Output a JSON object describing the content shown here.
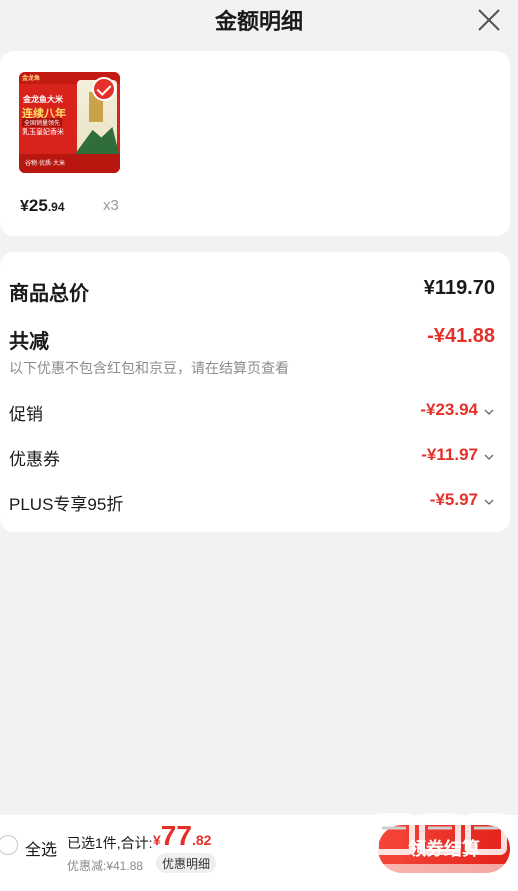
{
  "header": {
    "title": "金额明细"
  },
  "product": {
    "thumbnail": {
      "brand": "金龙鱼",
      "line1": "金龙鱼大米",
      "line2": "连续八年",
      "line3": "全国销量领先",
      "line4": "乳玉皇妃香米",
      "bottom": "谷物·优质·大米"
    },
    "price_symbol": "¥",
    "price_int": "25",
    "price_dec": ".94",
    "quantity": "x3"
  },
  "summary": {
    "total_label": "商品总价",
    "total_value": "¥119.70",
    "reduce_label": "共减",
    "reduce_value": "-¥41.88",
    "note": "以下优惠不包含红包和京豆，请在结算页查看",
    "promotion_label": "促销",
    "promotion_value": "-¥23.94",
    "coupon_label": "优惠券",
    "coupon_value": "-¥11.97",
    "plus_label": "PLUS专享95折",
    "plus_value": "-¥5.97"
  },
  "bottom_bar": {
    "select_all_label": "全选",
    "selected_summary": "已选1件,合计:",
    "total_symbol": "¥",
    "total_int": "77",
    "total_dec": ".82",
    "discount_summary": "优惠减:¥41.88",
    "detail_pill": "优惠明细",
    "checkout_label": "领券结算"
  },
  "colors": {
    "accent": "#e5302a",
    "background": "#f2f2f2",
    "card": "#ffffff",
    "muted_text": "#8c8c8c"
  },
  "icons": [
    "close-icon",
    "chevron-down-icon",
    "check-icon",
    "radio-icon"
  ]
}
